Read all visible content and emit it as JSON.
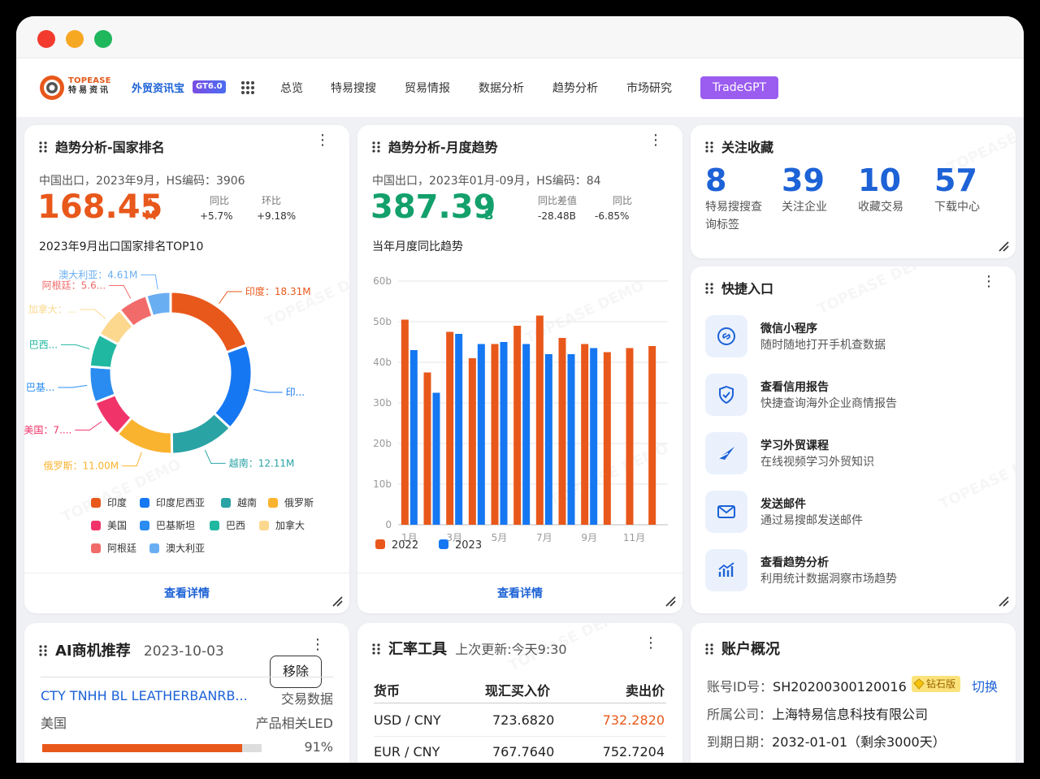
{
  "nav": {
    "logo_en": "TOPEASE",
    "logo_cn": "特易资讯",
    "product": "外贸资讯宝",
    "badge": "GT6.0",
    "items": [
      "总览",
      "特易搜搜",
      "贸易情报",
      "数据分析",
      "趋势分析",
      "市场研究"
    ],
    "gpt_button": "TradeGPT"
  },
  "country_rank": {
    "title": "趋势分析-国家排名",
    "subtitle": "中国出口，2023年9月，HS编码：3906",
    "value": "168.45",
    "unit": "M",
    "yoy_label": "同比",
    "yoy_value": "+5.7%",
    "mom_label": "环比",
    "mom_value": "+9.18%",
    "chart_title": "2023年9月出口国家排名TOP10",
    "detail": "查看详情",
    "colors": {
      "value": "#e8581b"
    }
  },
  "monthly_trend": {
    "title": "趋势分析-月度趋势",
    "subtitle": "中国出口，2023年01月-09月，HS编码：84",
    "value": "387.39",
    "unit": "B",
    "diff_label": "同比差值",
    "diff_value": "-28.48B",
    "yoy_label": "同比",
    "yoy_value": "-6.85%",
    "chart_title": "当年月度同比趋势",
    "detail": "查看详情",
    "colors": {
      "value": "#13a06b"
    }
  },
  "favorites": {
    "title": "关注收藏",
    "items": [
      {
        "value": "8",
        "label": "特易搜搜查询标签"
      },
      {
        "value": "39",
        "label": "关注企业"
      },
      {
        "value": "10",
        "label": "收藏交易"
      },
      {
        "value": "57",
        "label": "下载中心"
      }
    ]
  },
  "quick": {
    "title": "快捷入口",
    "items": [
      {
        "title": "微信小程序",
        "desc": "随时随地打开手机查数据",
        "icon": "link-icon"
      },
      {
        "title": "查看信用报告",
        "desc": "快捷查询海外企业商情报告",
        "icon": "shield-icon"
      },
      {
        "title": "学习外贸课程",
        "desc": "在线视频学习外贸知识",
        "icon": "paper-plane-icon"
      },
      {
        "title": "发送邮件",
        "desc": "通过易搜邮发送邮件",
        "icon": "mail-icon"
      },
      {
        "title": "查看趋势分析",
        "desc": "利用统计数据洞察市场趋势",
        "icon": "trend-chart-icon"
      }
    ]
  },
  "ai": {
    "title": "AI商机推荐",
    "date": "2023-10-03",
    "remove": "移除",
    "company": "CTY TNHH BL LEATHERBANRB...",
    "company_tag": "交易数据",
    "country": "美国",
    "product_tag": "产品相关LED",
    "percent": "91%",
    "progress": 0.91
  },
  "fx": {
    "title": "汇率工具",
    "updated": "上次更新:今天9:30",
    "headers": [
      "货币",
      "现汇买入价",
      "卖出价"
    ],
    "rows": [
      {
        "pair": "USD / CNY",
        "buy": "723.6820",
        "sell": "732.2820"
      },
      {
        "pair": "EUR / CNY",
        "buy": "767.7640",
        "sell": "752.7204"
      }
    ]
  },
  "account": {
    "title": "账户概况",
    "id_label": "账号ID号：",
    "id_value": "SH20200300120016",
    "level": "钻石版",
    "switch": "切换",
    "company_label": "所属公司：",
    "company_value": "上海特易信息科技有限公司",
    "expire_label": "到期日期：",
    "expire_value": "2032-01-01（剩余3000天）"
  },
  "watermark": "TOPEASE DEMO",
  "chart_data": [
    {
      "type": "pie",
      "title": "2023年9月出口国家排名TOP10",
      "categories": [
        "印度",
        "印度尼西亚",
        "越南",
        "俄罗斯",
        "美国",
        "巴基斯坦",
        "巴西",
        "加拿大",
        "阿根廷",
        "澳大利亚"
      ],
      "values": [
        18.31,
        16.5,
        12.11,
        11.0,
        7.2,
        6.8,
        6.3,
        5.9,
        5.6,
        4.61
      ],
      "labels": [
        "印度：18.31M",
        "印...",
        "越南：12.11M",
        "俄罗斯：11.00M",
        "美国：7....",
        "巴基...",
        "巴西...",
        "加拿大：...",
        "阿根廷：5.6...",
        "澳大利亚：4.61M"
      ],
      "colors": [
        "#e8581b",
        "#1677f2",
        "#2aa3a5",
        "#fab32f",
        "#f0346a",
        "#2a8cf0",
        "#20b8a0",
        "#fcd88f",
        "#f26b6b",
        "#6aaef2"
      ],
      "legend": "bottom"
    },
    {
      "type": "bar",
      "title": "当年月度同比趋势",
      "categories": [
        "1月",
        "2月",
        "3月",
        "4月",
        "5月",
        "6月",
        "7月",
        "8月",
        "9月",
        "10月",
        "11月",
        "12月"
      ],
      "tick_labels": [
        "1月",
        "3月",
        "5月",
        "7月",
        "9月",
        "11月"
      ],
      "y_ticks": [
        "0",
        "10b",
        "20b",
        "30b",
        "40b",
        "50b",
        "60b"
      ],
      "ylim": [
        0,
        60
      ],
      "series": [
        {
          "name": "2022",
          "color": "#e8581b",
          "values": [
            50.5,
            37.5,
            47.5,
            41,
            44.5,
            49,
            51.5,
            46,
            44.5,
            42.5,
            43.5,
            44
          ]
        },
        {
          "name": "2023",
          "color": "#1677f2",
          "values": [
            43,
            32.5,
            47,
            44.5,
            45,
            44.5,
            42,
            42,
            43.5,
            null,
            null,
            null
          ]
        }
      ],
      "grid": true,
      "legend": "bottom-left"
    }
  ]
}
